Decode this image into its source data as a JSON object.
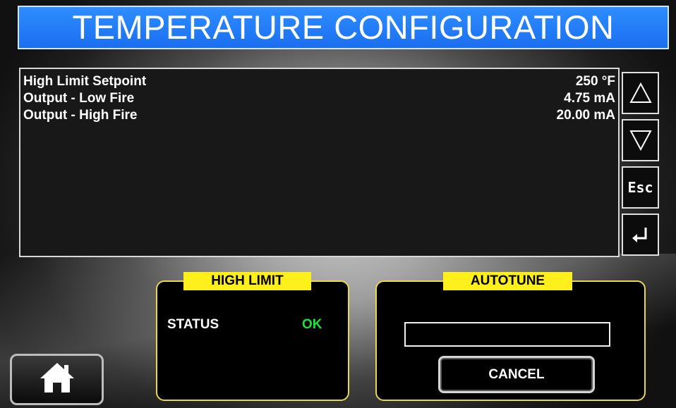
{
  "header": {
    "title": "TEMPERATURE CONFIGURATION"
  },
  "settings": {
    "rows": [
      {
        "label": "High Limit Setpoint",
        "value": "250 °F"
      },
      {
        "label": "Output - Low Fire",
        "value": "4.75 mA"
      },
      {
        "label": "Output - High Fire",
        "value": "20.00 mA"
      }
    ]
  },
  "nav": {
    "up_icon": "triangle-up-icon",
    "down_icon": "triangle-down-icon",
    "esc_label": "Esc",
    "enter_icon": "enter-return-icon"
  },
  "high_limit": {
    "title": "HIGH LIMIT",
    "status_label": "STATUS",
    "status_value": "OK",
    "status_color": "#19e23a"
  },
  "autotune": {
    "title": "AUTOTUNE",
    "field_value": "",
    "cancel_label": "CANCEL"
  },
  "home": {
    "icon": "home-icon"
  },
  "colors": {
    "title_bar": "#2f8dff",
    "group_title_bg": "#ffef1a",
    "group_border": "#e8d84a"
  }
}
